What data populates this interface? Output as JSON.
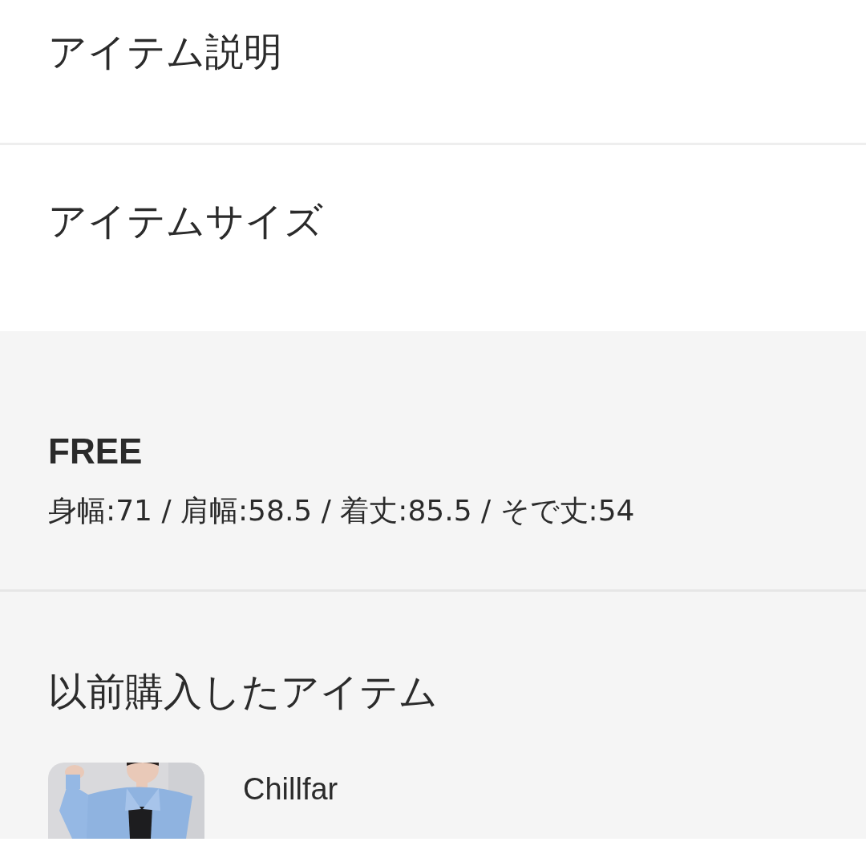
{
  "sections": [
    {
      "title": "アイテム説明"
    },
    {
      "title": "アイテムサイズ"
    }
  ],
  "size_info": {
    "size": "FREE",
    "measurements": "身幅:71 / 肩幅:58.5 / 着丈:85.5 / そで丈:54"
  },
  "purchased": {
    "title": "以前購入したアイテム",
    "items": [
      {
        "kind": "picture",
        "brand": "Chillfar"
      }
    ]
  }
}
